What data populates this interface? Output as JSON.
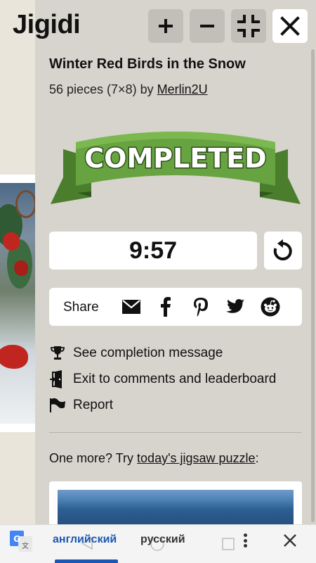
{
  "app": {
    "logo": "Jigidi"
  },
  "toolbar": {
    "zoom_in_icon": "plus-icon",
    "zoom_out_icon": "minus-icon",
    "fullscreen_icon": "fullscreen-exit-icon",
    "close_icon": "close-icon"
  },
  "puzzle": {
    "title": "Winter Red Birds in the Snow",
    "pieces_text": "56 pieces (7×8) by ",
    "author": "Merlin2U"
  },
  "status": {
    "ribbon_text": "COMPLETED",
    "ribbon_color": "#5f9a3c"
  },
  "timer": {
    "value": "9:57",
    "restart_icon": "restart-icon"
  },
  "share": {
    "label": "Share",
    "icons": [
      "email-icon",
      "facebook-icon",
      "pinterest-icon",
      "twitter-icon",
      "reddit-icon"
    ]
  },
  "menu": {
    "completion": "See completion message",
    "exit": "Exit to comments and leaderboard",
    "report": "Report"
  },
  "more": {
    "prefix": "One more? Try ",
    "link": "today's jigsaw puzzle",
    "suffix": ":"
  },
  "translate": {
    "source_lang": "английский",
    "target_lang": "русский"
  },
  "colors": {
    "panel": "#d7d4cd",
    "button": "#c2bfb8",
    "accent_blue": "#1a57b5",
    "ribbon_green": "#5f9a3c"
  }
}
